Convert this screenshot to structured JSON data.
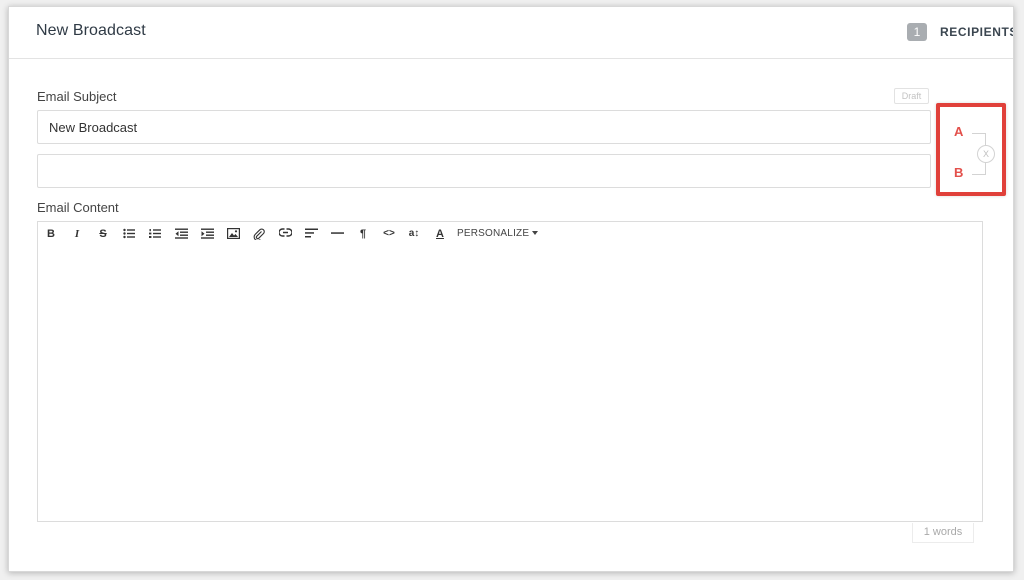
{
  "header": {
    "title": "New Broadcast",
    "recipients_count": "1",
    "recipients_label": "RECIPIENTS"
  },
  "subject": {
    "label": "Email Subject",
    "draft_badge": "Draft",
    "variant_a_value": "New Broadcast",
    "variant_b_value": "",
    "variant_b_placeholder": ""
  },
  "ab_test": {
    "a_label": "A",
    "b_label": "B",
    "swap_symbol": "X",
    "highlight_color": "#e0403a"
  },
  "content": {
    "label": "Email Content",
    "toolbar": [
      {
        "name": "bold",
        "icon": "bold-icon",
        "glyph": "B"
      },
      {
        "name": "italic",
        "icon": "italic-icon",
        "glyph": "I"
      },
      {
        "name": "strikethrough",
        "icon": "strikethrough-icon",
        "glyph": "S"
      },
      {
        "name": "unordered-list",
        "icon": "bullet-list-icon"
      },
      {
        "name": "ordered-list",
        "icon": "numbered-list-icon"
      },
      {
        "name": "outdent",
        "icon": "outdent-icon"
      },
      {
        "name": "indent",
        "icon": "indent-icon"
      },
      {
        "name": "image",
        "icon": "image-icon"
      },
      {
        "name": "attachment",
        "icon": "paperclip-icon"
      },
      {
        "name": "link",
        "icon": "link-icon"
      },
      {
        "name": "align",
        "icon": "align-left-icon"
      },
      {
        "name": "horizontal-rule",
        "icon": "horizontal-rule-icon"
      },
      {
        "name": "paragraph",
        "icon": "paragraph-icon",
        "glyph": "¶"
      },
      {
        "name": "code",
        "icon": "code-icon",
        "glyph": "<>"
      },
      {
        "name": "font-size",
        "icon": "font-size-icon",
        "glyph": "a↕"
      },
      {
        "name": "text-color",
        "icon": "text-color-icon",
        "glyph": "A"
      }
    ],
    "personalize_label": "PERSONALIZE",
    "body": "",
    "word_count": "1 words"
  }
}
